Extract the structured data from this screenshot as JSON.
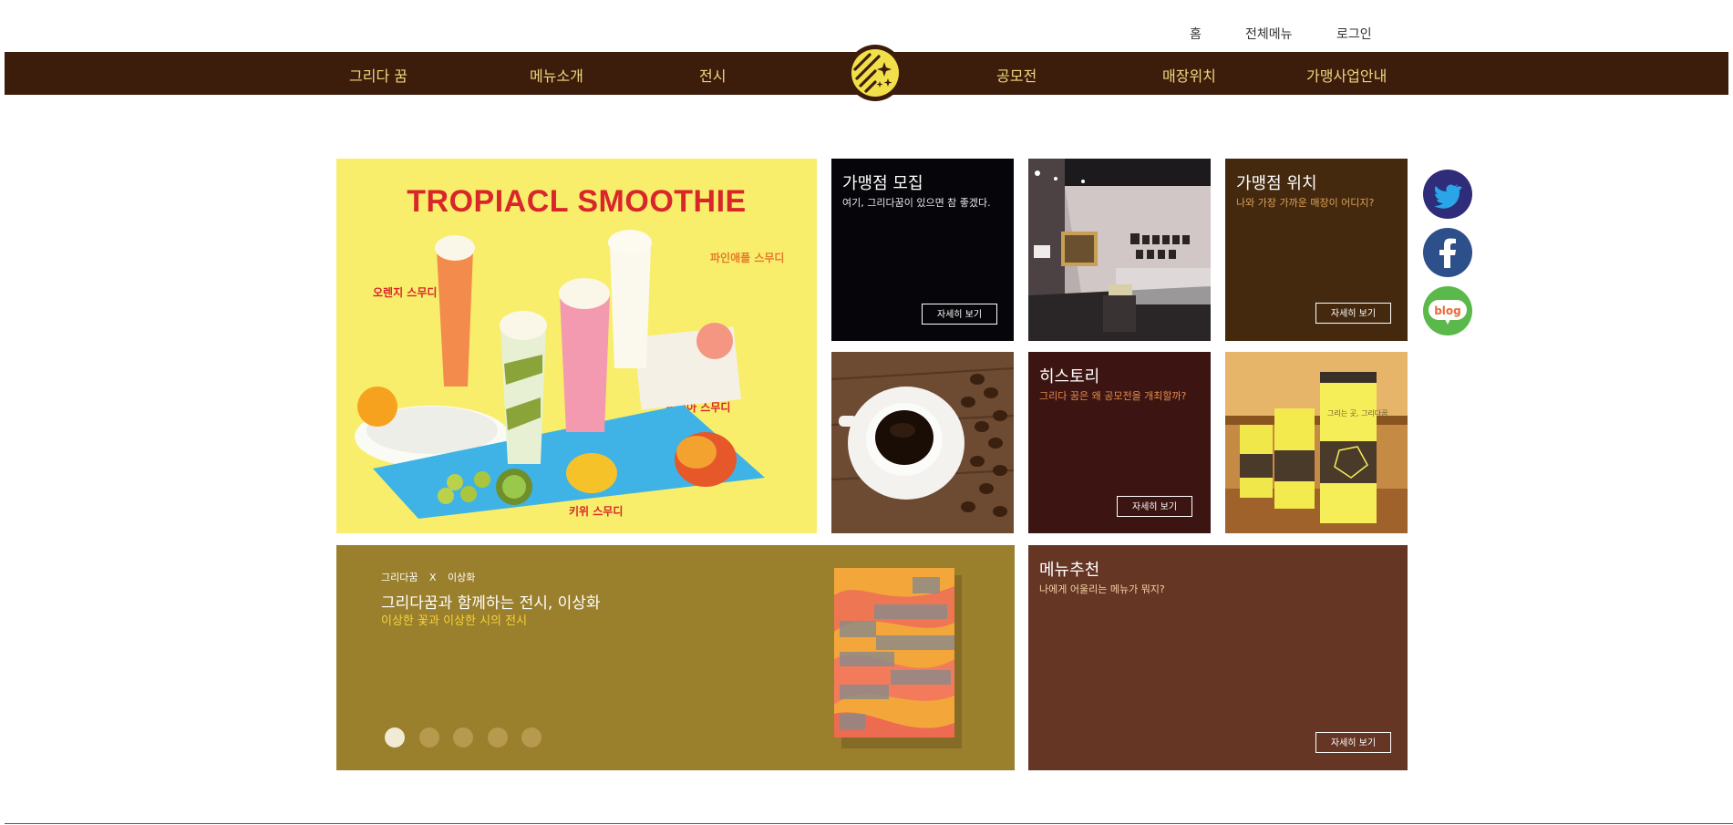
{
  "top_links": [
    "홈",
    "전체메뉴",
    "로그인"
  ],
  "nav": {
    "items": [
      "그리다 꿈",
      "메뉴소개",
      "전시",
      "공모전",
      "매장위치",
      "가맹사업안내"
    ]
  },
  "colors": {
    "nav_bg": "#3c1d0c",
    "nav_text": "#f2d77e",
    "brand_yellow": "#f2e04a",
    "franchise_bg": "#06060a",
    "location_bg": "#44290e",
    "history_bg": "#3c1512",
    "exhibition_bg": "#9a7f2d",
    "recommend_bg": "#663625"
  },
  "banner": {
    "title": "TROPIACL SMOOTHIE",
    "flavors": [
      "오렌지 스무디",
      "파인애플 스무디",
      "복숭아 스무디",
      "키위 스무디"
    ]
  },
  "tiles": {
    "franchise": {
      "title": "가맹점 모집",
      "subtitle": "여기, 그리다꿈이 있으면 참 좋겠다.",
      "button": "자세히 보기"
    },
    "location": {
      "title": "가맹점 위치",
      "subtitle": "나와 가장 가까운 매장이 어디지?",
      "button": "자세히 보기"
    },
    "history": {
      "title": "히스토리",
      "subtitle": "그리다 꿈은 왜 공모전을 개최할까?",
      "button": "자세히 보기"
    },
    "recommend": {
      "title": "메뉴추천",
      "subtitle": "나에게 어울리는 메뉴가 뭐지?",
      "button": "자세히 보기"
    }
  },
  "exhibition": {
    "collab_left": "그리다꿈",
    "collab_x": "X",
    "collab_right": "이상화",
    "title": "그리다꿈과 함께하는 전시, 이상화",
    "subtitle": "이상한 꽃과 이상한 시의 전시",
    "slide_count": 5,
    "active_slide": 1
  },
  "social": [
    "twitter-icon",
    "facebook-icon",
    "blog-icon"
  ],
  "social_labels": {
    "blog": "blog"
  },
  "cups_text": "그리는 곳, 그리다꿈"
}
